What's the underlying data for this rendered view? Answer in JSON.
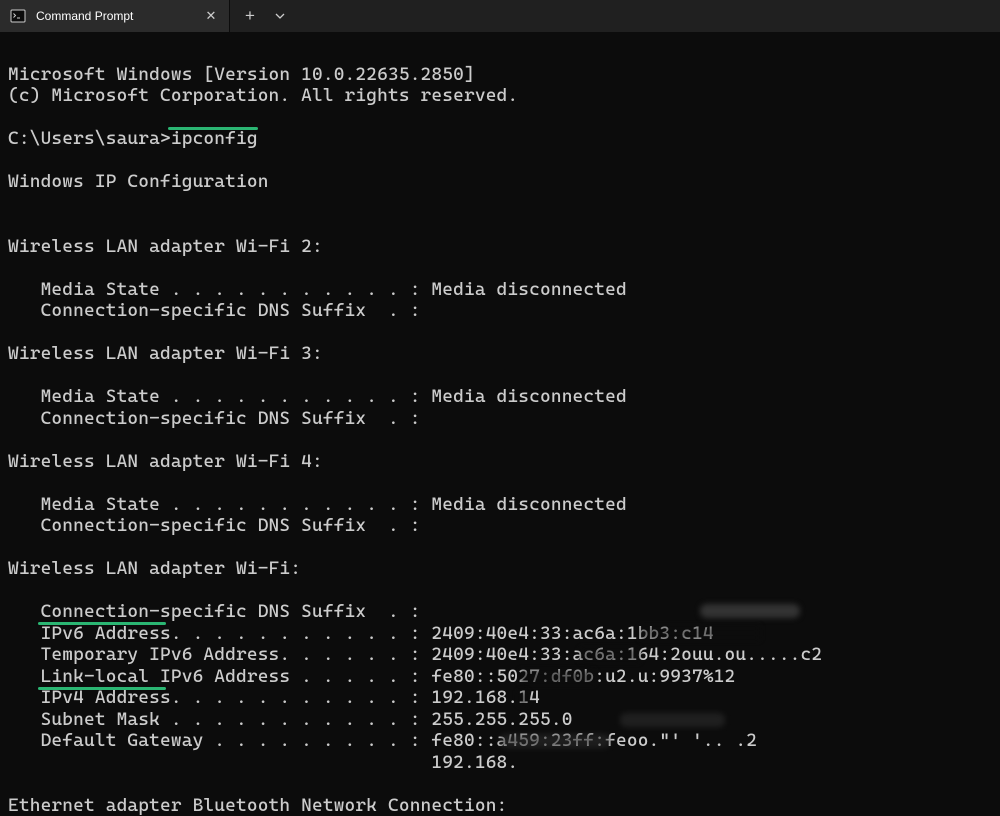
{
  "titlebar": {
    "tab_title": "Command Prompt",
    "close_symbol": "✕",
    "new_tab_symbol": "+",
    "dropdown_symbol": "⌄"
  },
  "terminal": {
    "banner_line1": "Microsoft Windows [Version 10.0.22635.2850]",
    "banner_line2": "(c) Microsoft Corporation. All rights reserved.",
    "prompt": "C:\\Users\\saura>",
    "command": "ipconfig",
    "header": "Windows IP Configuration",
    "sections": [
      {
        "title": "Wireless LAN adapter Wi-Fi 2:",
        "lines": [
          "   Media State . . . . . . . . . . . : Media disconnected",
          "   Connection-specific DNS Suffix  . :"
        ]
      },
      {
        "title": "Wireless LAN adapter Wi-Fi 3:",
        "lines": [
          "   Media State . . . . . . . . . . . : Media disconnected",
          "   Connection-specific DNS Suffix  . :"
        ]
      },
      {
        "title": "Wireless LAN adapter Wi-Fi 4:",
        "lines": [
          "   Media State . . . . . . . . . . . : Media disconnected",
          "   Connection-specific DNS Suffix  . :"
        ]
      },
      {
        "title": "Wireless LAN adapter Wi-Fi:",
        "lines": [
          "   Connection-specific DNS Suffix  . :",
          "   IPv6 Address. . . . . . . . . . . : 2409:40e4:33:ac6a:1bb3:c14",
          "   Temporary IPv6 Address. . . . . . : 2409:40e4:33:ac6a:164:2ouu.ou.....c2",
          "   Link-local IPv6 Address . . . . . : fe80::5027:df0b:u2.u:9937%12",
          "   IPv4 Address. . . . . . . . . . . : 192.168.14",
          "   Subnet Mask . . . . . . . . . . . : 255.255.255.0",
          "   Default Gateway . . . . . . . . . : fe80::a459:23ff:feoo.\"' '.. .2",
          "                                       192.168."
        ]
      },
      {
        "title": "Ethernet adapter Bluetooth Network Connection:",
        "lines": []
      }
    ]
  }
}
